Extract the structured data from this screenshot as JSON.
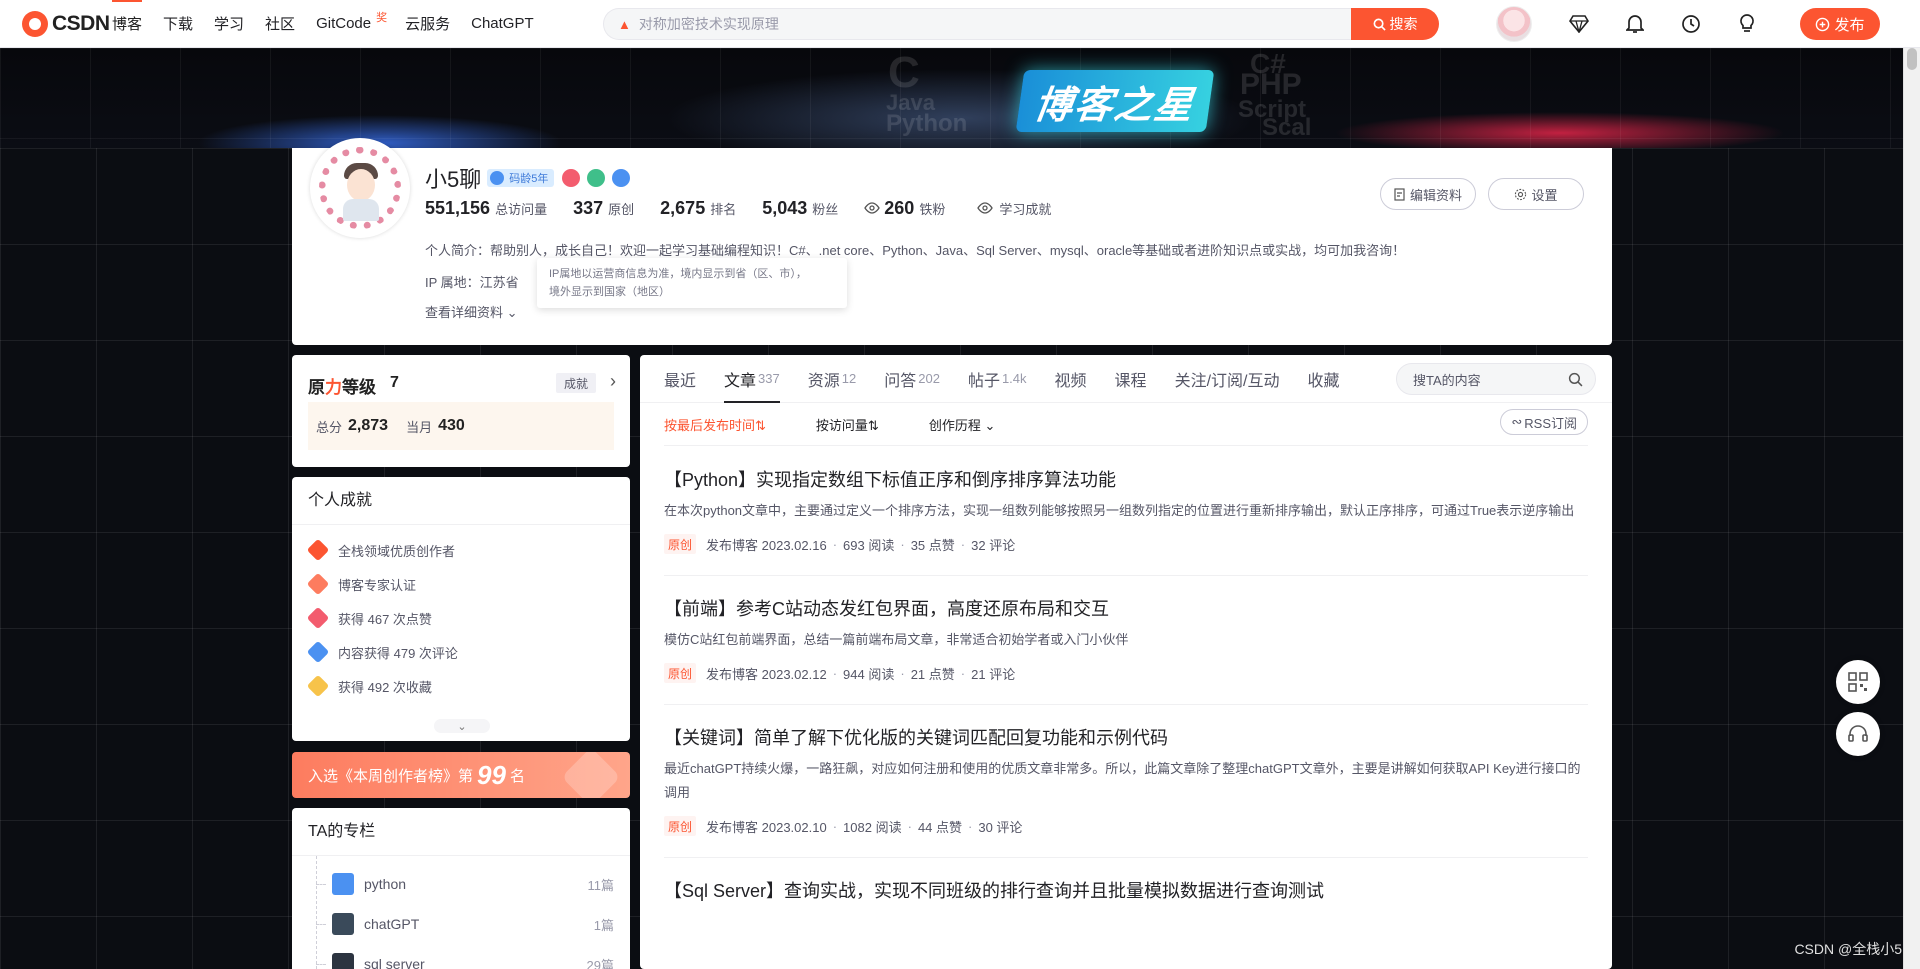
{
  "topnav": {
    "logo_text": "CSDN",
    "links": [
      {
        "label": "博客",
        "active": true
      },
      {
        "label": "下载"
      },
      {
        "label": "学习"
      },
      {
        "label": "社区"
      },
      {
        "label": "GitCode",
        "badge": "奖"
      },
      {
        "label": "云服务"
      },
      {
        "label": "ChatGPT"
      }
    ],
    "search_placeholder": "对称加密技术实现原理",
    "search_button": "搜索",
    "publish_button": "发布",
    "icons": [
      "avatar",
      "diamond-icon",
      "bell-icon",
      "clock-icon",
      "bulb-icon"
    ]
  },
  "banner": {
    "title": "博客之星",
    "deco_words": [
      "C",
      "Java",
      "Python",
      "C#",
      "PHP",
      "Script",
      "Scal"
    ]
  },
  "profile": {
    "name": "小5聊",
    "age_badge": "码龄5年",
    "stats": [
      {
        "num": "551,156",
        "label": "总访问量"
      },
      {
        "num": "337",
        "label": "原创"
      },
      {
        "num": "2,675",
        "label": "排名"
      },
      {
        "num": "5,043",
        "label": "粉丝"
      },
      {
        "num": "260",
        "label": "铁粉"
      }
    ],
    "achievement_link": "学习成就",
    "intro": "个人简介：帮助别人，成长自己！欢迎一起学习基础编程知识！C#、.net core、Python、Java、Sql Server、mysql、oracle等基础或者进阶知识点或实战，均可加我咨询！",
    "ip": "IP 属地：江苏省",
    "tooltip_line1": "IP属地以运营商信息为准，境内显示到省（区、市），",
    "tooltip_line2": "境外显示到国家（地区）",
    "more_link": "查看详细资料",
    "edit_button": "编辑资料",
    "settings_button": "设置"
  },
  "level": {
    "title_prefix": "原",
    "title_red": "力",
    "title_suffix": "等级",
    "level": "7",
    "tag": "成就",
    "total_label": "总分",
    "total": "2,873",
    "month_label": "当月",
    "month": "430"
  },
  "achievements": {
    "title": "个人成就",
    "items": [
      {
        "label": "全栈领域优质创作者",
        "color": "#fc5531"
      },
      {
        "label": "博客专家认证",
        "color": "#fd7c5f"
      },
      {
        "label": "获得 467 次点赞",
        "color": "#f35c6e"
      },
      {
        "label": "内容获得 479 次评论",
        "color": "#4b91f1"
      },
      {
        "label": "获得 492 次收藏",
        "color": "#f7c34a"
      }
    ]
  },
  "rank_banner": {
    "before": "入选《本周创作者榜》第",
    "number": "99",
    "after": "名"
  },
  "columns": {
    "title": "TA的专栏",
    "items": [
      {
        "name": "python",
        "count": "11篇",
        "color": "#4b91f1"
      },
      {
        "name": "chatGPT",
        "count": "1篇",
        "color": "#3a4a5a"
      },
      {
        "name": "sql server",
        "count": "29篇",
        "color": "#2c3440"
      }
    ]
  },
  "main": {
    "tabs": [
      {
        "label": "最近",
        "count": ""
      },
      {
        "label": "文章",
        "count": "337",
        "active": true
      },
      {
        "label": "资源",
        "count": "12"
      },
      {
        "label": "问答",
        "count": "202"
      },
      {
        "label": "帖子",
        "count": "1.4k"
      },
      {
        "label": "视频",
        "count": ""
      },
      {
        "label": "课程",
        "count": ""
      },
      {
        "label": "关注/订阅/互动",
        "count": ""
      },
      {
        "label": "收藏",
        "count": ""
      }
    ],
    "search_placeholder": "搜TA的内容",
    "sorts": [
      {
        "label": "按最后发布时间⇅",
        "active": true
      },
      {
        "label": "按访问量⇅"
      },
      {
        "label": "创作历程"
      }
    ],
    "rss": "RSS订阅",
    "articles": [
      {
        "title": "【Python】实现指定数组下标值正序和倒序排序算法功能",
        "desc": "在本次python文章中，主要通过定义一个排序方法，实现一组数列能够按照另一组数列指定的位置进行重新排序输出，默认正序排序，可通过True表示逆序输出",
        "tag": "原创",
        "date": "发布博客 2023.02.16",
        "views": "693 阅读",
        "likes": "35 点赞",
        "comments": "32 评论"
      },
      {
        "title": "【前端】参考C站动态发红包界面，高度还原布局和交互",
        "desc": "模仿C站红包前端界面，总结一篇前端布局文章，非常适合初始学者或入门小伙伴",
        "tag": "原创",
        "date": "发布博客 2023.02.12",
        "views": "944 阅读",
        "likes": "21 点赞",
        "comments": "21 评论"
      },
      {
        "title": "【关键词】简单了解下优化版的关键词匹配回复功能和示例代码",
        "desc": "最近chatGPT持续火爆，一路狂飙，对应如何注册和使用的优质文章非常多。所以，此篇文章除了整理chatGPT文章外，主要是讲解如何获取API Key进行接口的调用",
        "tag": "原创",
        "date": "发布博客 2023.02.10",
        "views": "1082 阅读",
        "likes": "44 点赞",
        "comments": "30 评论"
      },
      {
        "title": "【Sql Server】查询实战，实现不同班级的排行查询并且批量模拟数据进行查询测试",
        "desc": "",
        "tag": "",
        "date": "",
        "views": "",
        "likes": "",
        "comments": ""
      }
    ]
  },
  "watermark": "CSDN @全栈小5"
}
